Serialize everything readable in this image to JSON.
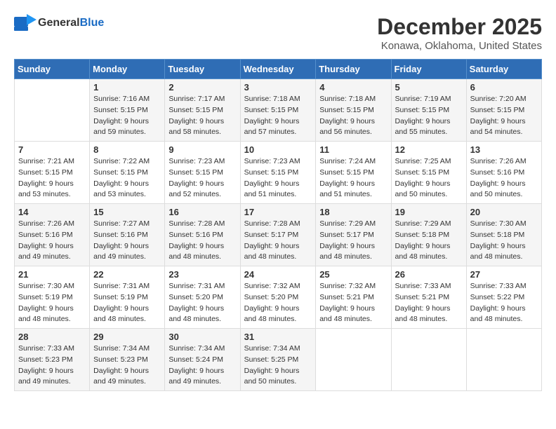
{
  "logo": {
    "general": "General",
    "blue": "Blue"
  },
  "header": {
    "month": "December 2025",
    "location": "Konawa, Oklahoma, United States"
  },
  "weekdays": [
    "Sunday",
    "Monday",
    "Tuesday",
    "Wednesday",
    "Thursday",
    "Friday",
    "Saturday"
  ],
  "weeks": [
    [
      {
        "day": "",
        "info": ""
      },
      {
        "day": "1",
        "info": "Sunrise: 7:16 AM\nSunset: 5:15 PM\nDaylight: 9 hours\nand 59 minutes."
      },
      {
        "day": "2",
        "info": "Sunrise: 7:17 AM\nSunset: 5:15 PM\nDaylight: 9 hours\nand 58 minutes."
      },
      {
        "day": "3",
        "info": "Sunrise: 7:18 AM\nSunset: 5:15 PM\nDaylight: 9 hours\nand 57 minutes."
      },
      {
        "day": "4",
        "info": "Sunrise: 7:18 AM\nSunset: 5:15 PM\nDaylight: 9 hours\nand 56 minutes."
      },
      {
        "day": "5",
        "info": "Sunrise: 7:19 AM\nSunset: 5:15 PM\nDaylight: 9 hours\nand 55 minutes."
      },
      {
        "day": "6",
        "info": "Sunrise: 7:20 AM\nSunset: 5:15 PM\nDaylight: 9 hours\nand 54 minutes."
      }
    ],
    [
      {
        "day": "7",
        "info": "Sunrise: 7:21 AM\nSunset: 5:15 PM\nDaylight: 9 hours\nand 53 minutes."
      },
      {
        "day": "8",
        "info": "Sunrise: 7:22 AM\nSunset: 5:15 PM\nDaylight: 9 hours\nand 53 minutes."
      },
      {
        "day": "9",
        "info": "Sunrise: 7:23 AM\nSunset: 5:15 PM\nDaylight: 9 hours\nand 52 minutes."
      },
      {
        "day": "10",
        "info": "Sunrise: 7:23 AM\nSunset: 5:15 PM\nDaylight: 9 hours\nand 51 minutes."
      },
      {
        "day": "11",
        "info": "Sunrise: 7:24 AM\nSunset: 5:15 PM\nDaylight: 9 hours\nand 51 minutes."
      },
      {
        "day": "12",
        "info": "Sunrise: 7:25 AM\nSunset: 5:15 PM\nDaylight: 9 hours\nand 50 minutes."
      },
      {
        "day": "13",
        "info": "Sunrise: 7:26 AM\nSunset: 5:16 PM\nDaylight: 9 hours\nand 50 minutes."
      }
    ],
    [
      {
        "day": "14",
        "info": "Sunrise: 7:26 AM\nSunset: 5:16 PM\nDaylight: 9 hours\nand 49 minutes."
      },
      {
        "day": "15",
        "info": "Sunrise: 7:27 AM\nSunset: 5:16 PM\nDaylight: 9 hours\nand 49 minutes."
      },
      {
        "day": "16",
        "info": "Sunrise: 7:28 AM\nSunset: 5:16 PM\nDaylight: 9 hours\nand 48 minutes."
      },
      {
        "day": "17",
        "info": "Sunrise: 7:28 AM\nSunset: 5:17 PM\nDaylight: 9 hours\nand 48 minutes."
      },
      {
        "day": "18",
        "info": "Sunrise: 7:29 AM\nSunset: 5:17 PM\nDaylight: 9 hours\nand 48 minutes."
      },
      {
        "day": "19",
        "info": "Sunrise: 7:29 AM\nSunset: 5:18 PM\nDaylight: 9 hours\nand 48 minutes."
      },
      {
        "day": "20",
        "info": "Sunrise: 7:30 AM\nSunset: 5:18 PM\nDaylight: 9 hours\nand 48 minutes."
      }
    ],
    [
      {
        "day": "21",
        "info": "Sunrise: 7:30 AM\nSunset: 5:19 PM\nDaylight: 9 hours\nand 48 minutes."
      },
      {
        "day": "22",
        "info": "Sunrise: 7:31 AM\nSunset: 5:19 PM\nDaylight: 9 hours\nand 48 minutes."
      },
      {
        "day": "23",
        "info": "Sunrise: 7:31 AM\nSunset: 5:20 PM\nDaylight: 9 hours\nand 48 minutes."
      },
      {
        "day": "24",
        "info": "Sunrise: 7:32 AM\nSunset: 5:20 PM\nDaylight: 9 hours\nand 48 minutes."
      },
      {
        "day": "25",
        "info": "Sunrise: 7:32 AM\nSunset: 5:21 PM\nDaylight: 9 hours\nand 48 minutes."
      },
      {
        "day": "26",
        "info": "Sunrise: 7:33 AM\nSunset: 5:21 PM\nDaylight: 9 hours\nand 48 minutes."
      },
      {
        "day": "27",
        "info": "Sunrise: 7:33 AM\nSunset: 5:22 PM\nDaylight: 9 hours\nand 48 minutes."
      }
    ],
    [
      {
        "day": "28",
        "info": "Sunrise: 7:33 AM\nSunset: 5:23 PM\nDaylight: 9 hours\nand 49 minutes."
      },
      {
        "day": "29",
        "info": "Sunrise: 7:34 AM\nSunset: 5:23 PM\nDaylight: 9 hours\nand 49 minutes."
      },
      {
        "day": "30",
        "info": "Sunrise: 7:34 AM\nSunset: 5:24 PM\nDaylight: 9 hours\nand 49 minutes."
      },
      {
        "day": "31",
        "info": "Sunrise: 7:34 AM\nSunset: 5:25 PM\nDaylight: 9 hours\nand 50 minutes."
      },
      {
        "day": "",
        "info": ""
      },
      {
        "day": "",
        "info": ""
      },
      {
        "day": "",
        "info": ""
      }
    ]
  ]
}
